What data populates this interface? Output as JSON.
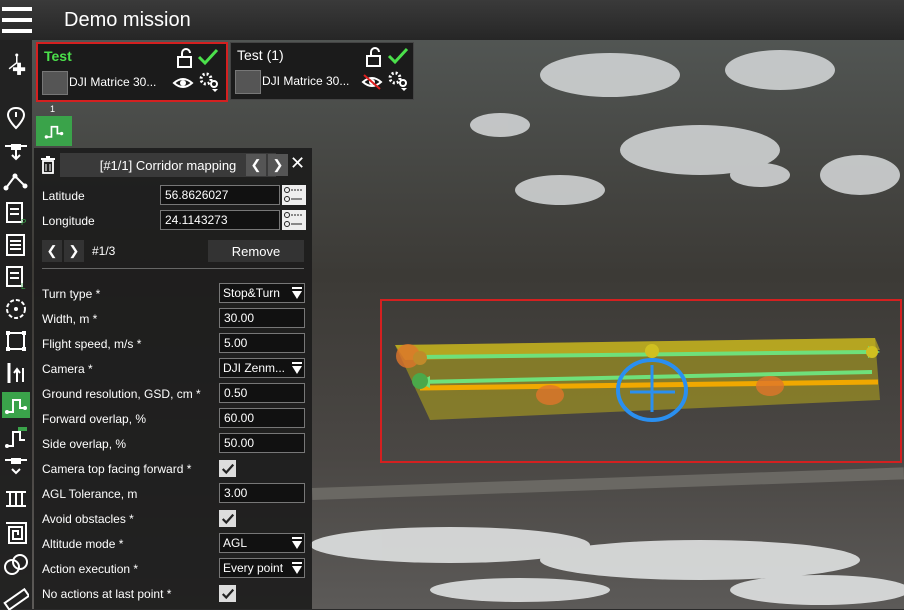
{
  "app": {
    "title": "Demo mission"
  },
  "drones": [
    {
      "name": "Test",
      "model": "DJI Matrice 30...",
      "selected": true,
      "name_color": "#4be04b"
    },
    {
      "name": "Test  (1)",
      "model": "DJI Matrice 30...",
      "selected": false,
      "name_color": "#ffffff"
    }
  ],
  "mission_tab": {
    "number": "1"
  },
  "panel": {
    "title": "[#1/1] Corridor mapping",
    "latitude_label": "Latitude",
    "latitude": "56.8626027",
    "longitude_label": "Longitude",
    "longitude": "24.1143273",
    "point_counter": "#1/3",
    "remove_label": "Remove",
    "settings": [
      {
        "label": "Turn type *",
        "kind": "select",
        "value": "Stop&Turn"
      },
      {
        "label": "Width, m *",
        "kind": "input",
        "value": "30.00"
      },
      {
        "label": "Flight speed, m/s *",
        "kind": "input",
        "value": "5.00"
      },
      {
        "label": "Camera *",
        "kind": "select",
        "value": "DJI Zenm..."
      },
      {
        "label": "Ground resolution, GSD, cm *",
        "kind": "input",
        "value": "0.50"
      },
      {
        "label": "Forward overlap, %",
        "kind": "input",
        "value": "60.00"
      },
      {
        "label": "Side overlap, %",
        "kind": "input",
        "value": "50.00"
      },
      {
        "label": "Camera top facing forward *",
        "kind": "check",
        "value": true
      },
      {
        "label": "AGL Tolerance, m",
        "kind": "input",
        "value": "3.00"
      },
      {
        "label": "Avoid obstacles *",
        "kind": "check",
        "value": true
      },
      {
        "label": "Altitude mode *",
        "kind": "select",
        "value": "AGL"
      },
      {
        "label": "Action execution *",
        "kind": "select",
        "value": "Every point"
      },
      {
        "label": "No actions at last point *",
        "kind": "check",
        "value": true
      }
    ]
  },
  "colors": {
    "accent_green": "#3aa34a",
    "selection_red": "#d42020",
    "route_green": "#6fe07a",
    "corridor_yellow": "#e8d21a"
  },
  "toolbar_icons": [
    "add-route-icon",
    "waypoint-icon",
    "drone-route-icon",
    "polyline-icon",
    "photo-plan-icon",
    "grid-plan-icon",
    "lines-plan-icon",
    "circle-icon",
    "square-area-icon",
    "vertical-scan-icon",
    "corridor-mapping-icon",
    "corridor-alt-icon",
    "drone-down-icon",
    "facade-icon",
    "spiral-icon",
    "orbit-icon",
    "ruler-icon"
  ]
}
